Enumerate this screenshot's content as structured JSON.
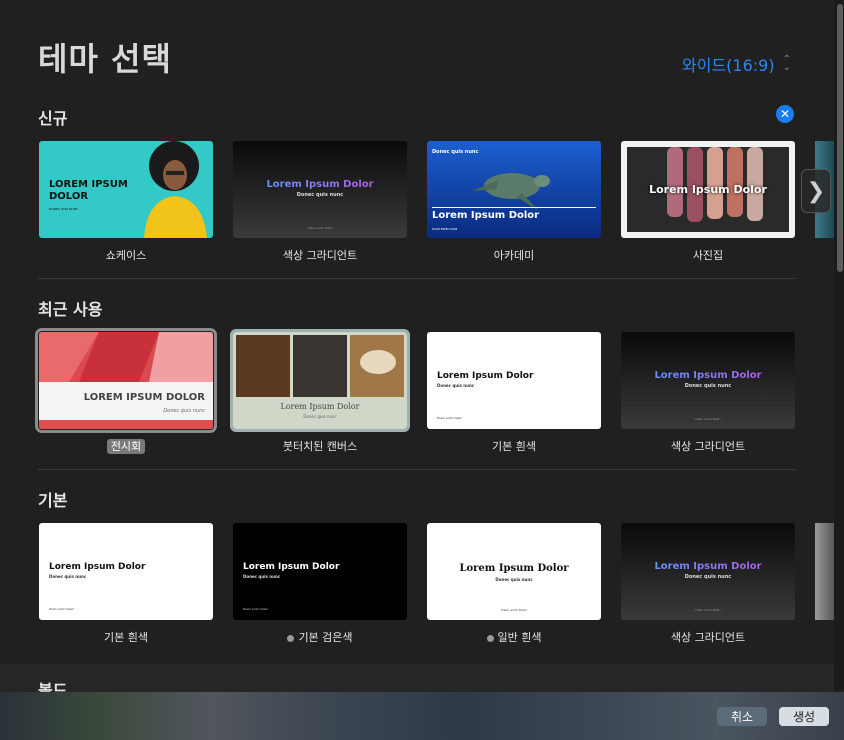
{
  "window": {
    "title": "테마 선택"
  },
  "aspect_selector": {
    "value": "와이드(16:9)"
  },
  "sections": {
    "new": {
      "title": "신규"
    },
    "recent": {
      "title": "최근 사용"
    },
    "basic": {
      "title": "기본"
    },
    "bold": {
      "title": "볼드"
    }
  },
  "themes": {
    "new": [
      {
        "label": "쇼케이스",
        "thumb_title": "LOREM IPSUM DOLOR",
        "thumb_sub": "DONEC QUIS NUNC"
      },
      {
        "label": "색상 그라디언트",
        "thumb_title": "Lorem Ipsum Dolor",
        "thumb_sub": "Donec quis nunc",
        "thumb_foot": "Diam enim Diam"
      },
      {
        "label": "아카데미",
        "thumb_top": "Donec quis nunc",
        "thumb_title": "Lorem Ipsum Dolor",
        "thumb_foot": "DIAM ENIM DIAM"
      },
      {
        "label": "사진집",
        "thumb_title": "Lorem Ipsum Dolor"
      }
    ],
    "recent": [
      {
        "label": "전시회",
        "thumb_title": "LOREM IPSUM DOLOR",
        "thumb_sub": "Donec quis nunc"
      },
      {
        "label": "붓터치된 캔버스",
        "thumb_title": "Lorem Ipsum Dolor",
        "thumb_sub": "Donec quis nunc"
      },
      {
        "label": "기본 흰색",
        "thumb_title": "Lorem Ipsum Dolor",
        "thumb_sub": "Donec quis nunc",
        "thumb_foot": "Diam enim Diam"
      },
      {
        "label": "색상 그라디언트",
        "thumb_title": "Lorem Ipsum Dolor",
        "thumb_sub": "Donec quis nunc",
        "thumb_foot": "Diam enim Diam"
      }
    ],
    "basic": [
      {
        "label": "기본 흰색",
        "thumb_title": "Lorem Ipsum Dolor",
        "thumb_sub": "Donec quis nunc",
        "thumb_foot": "Diam enim Diam"
      },
      {
        "label": "기본 검은색",
        "thumb_title": "Lorem Ipsum Dolor",
        "thumb_sub": "Donec quis nunc",
        "thumb_foot": "Diam enim Diam"
      },
      {
        "label": "일반 흰색",
        "thumb_title": "Lorem Ipsum Dolor",
        "thumb_sub": "Donec quis nunc",
        "thumb_foot": "Diam enim Diam"
      },
      {
        "label": "색상 그라디언트",
        "thumb_title": "Lorem Ipsum Dolor",
        "thumb_sub": "Donec quis nunc",
        "thumb_foot": "Diam enim Diam"
      }
    ]
  },
  "footer": {
    "cancel_label": "취소",
    "create_label": "생성"
  },
  "colors": {
    "accent": "#2e86f0",
    "background": "#202020"
  }
}
